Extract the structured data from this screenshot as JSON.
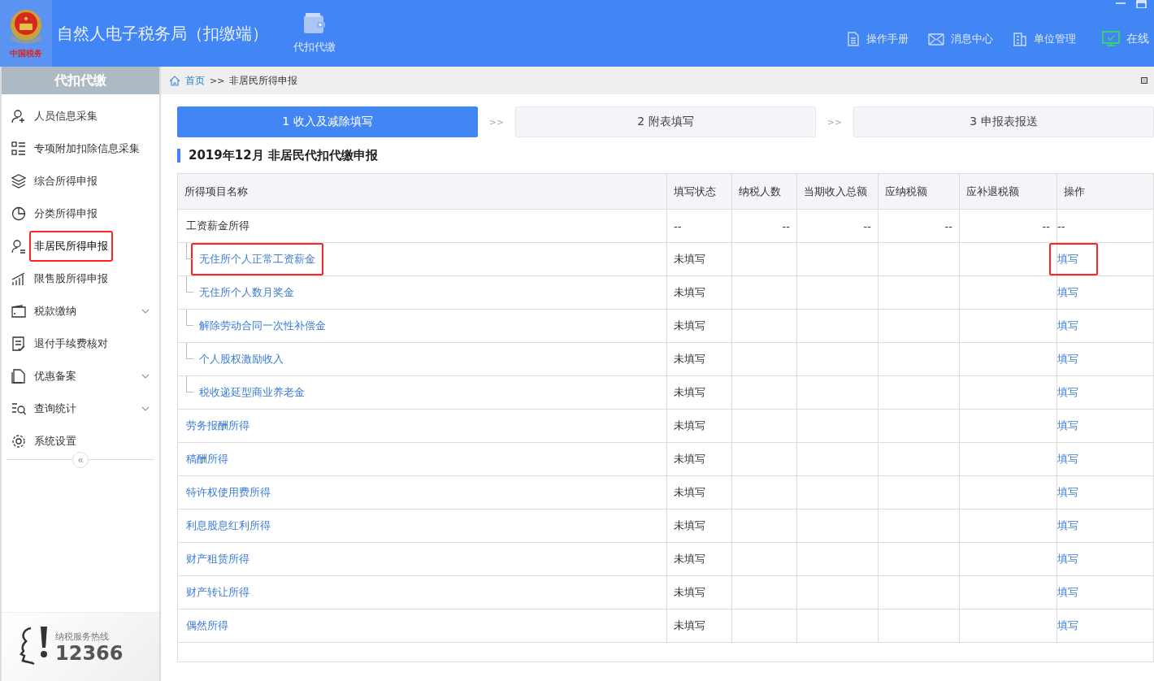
{
  "app": {
    "title": "自然人电子税务局（扣缴端）",
    "logo_text": "中国税务",
    "module": "代扣代缴"
  },
  "header_links": [
    {
      "kind": "manual",
      "label": "操作手册"
    },
    {
      "kind": "message",
      "label": "消息中心"
    },
    {
      "kind": "company",
      "label": "单位管理"
    },
    {
      "kind": "online",
      "label": "在线"
    }
  ],
  "sidebar": {
    "title": "代扣代缴",
    "items": [
      {
        "label": "人员信息采集",
        "selected": false,
        "highlighted": false
      },
      {
        "label": "专项附加扣除信息采集",
        "selected": false,
        "highlighted": false
      },
      {
        "label": "综合所得申报",
        "selected": false,
        "highlighted": false
      },
      {
        "label": "分类所得申报",
        "selected": false,
        "highlighted": false
      },
      {
        "label": "非居民所得申报",
        "selected": true,
        "highlighted": true
      },
      {
        "label": "限售股所得申报",
        "selected": false,
        "highlighted": false
      },
      {
        "label": "税款缴纳",
        "selected": false,
        "highlighted": false,
        "expanded": false
      },
      {
        "label": "退付手续费核对",
        "selected": false,
        "highlighted": false
      },
      {
        "label": "优惠备案",
        "selected": false,
        "highlighted": false,
        "expanded": false
      },
      {
        "label": "查询统计",
        "selected": false,
        "highlighted": false,
        "expanded": false
      },
      {
        "label": "系统设置",
        "selected": false,
        "highlighted": false
      }
    ],
    "collapse": "«",
    "hotline": {
      "label": "纳税服务热线",
      "number": "12366"
    }
  },
  "breadcrumb": {
    "home": "首页",
    "separator": ">>",
    "current": "非居民所得申报"
  },
  "steps": [
    {
      "label": "1 收入及减除填写",
      "selected": true
    },
    {
      "label": "2 附表填写",
      "selected": false
    },
    {
      "label": "3 申报表报送",
      "selected": false
    }
  ],
  "step_separator": ">>",
  "section_title": "2019年12月  非居民代扣代缴申报",
  "table": {
    "columns": [
      "所得项目名称",
      "填写状态",
      "纳税人数",
      "当期收入总额",
      "应纳税额",
      "应补退税额",
      "操作"
    ],
    "rows": [
      {
        "kind": "group",
        "name": "工资薪金所得",
        "status": "--",
        "taxpayers": "--",
        "income": "--",
        "tax": "--",
        "refund": "--",
        "action": "--",
        "name_highlighted": false,
        "action_highlighted": false,
        "children": [
          {
            "kind": "item",
            "name": "无住所个人正常工资薪金",
            "status": "未填写",
            "action": "填写",
            "name_highlighted": true,
            "action_highlighted": true
          },
          {
            "kind": "item",
            "name": "无住所个人数月奖金",
            "status": "未填写",
            "action": "填写",
            "name_highlighted": false,
            "action_highlighted": false
          },
          {
            "kind": "item",
            "name": "解除劳动合同一次性补偿金",
            "status": "未填写",
            "action": "填写",
            "name_highlighted": false,
            "action_highlighted": false
          },
          {
            "kind": "item",
            "name": "个人股权激励收入",
            "status": "未填写",
            "action": "填写",
            "name_highlighted": false,
            "action_highlighted": false
          },
          {
            "kind": "item",
            "name": "税收递延型商业养老金",
            "status": "未填写",
            "action": "填写",
            "name_highlighted": false,
            "action_highlighted": false
          }
        ]
      },
      {
        "kind": "item",
        "name": "劳务报酬所得",
        "status": "未填写",
        "action": "填写",
        "name_highlighted": false,
        "action_highlighted": false
      },
      {
        "kind": "item",
        "name": "稿酬所得",
        "status": "未填写",
        "action": "填写",
        "name_highlighted": false,
        "action_highlighted": false
      },
      {
        "kind": "item",
        "name": "特许权使用费所得",
        "status": "未填写",
        "action": "填写",
        "name_highlighted": false,
        "action_highlighted": false
      },
      {
        "kind": "item",
        "name": "利息股息红利所得",
        "status": "未填写",
        "action": "填写",
        "name_highlighted": false,
        "action_highlighted": false
      },
      {
        "kind": "item",
        "name": "财产租赁所得",
        "status": "未填写",
        "action": "填写",
        "name_highlighted": false,
        "action_highlighted": false
      },
      {
        "kind": "item",
        "name": "财产转让所得",
        "status": "未填写",
        "action": "填写",
        "name_highlighted": false,
        "action_highlighted": false
      },
      {
        "kind": "item",
        "name": "偶然所得",
        "status": "未填写",
        "action": "填写",
        "name_highlighted": false,
        "action_highlighted": false
      }
    ]
  }
}
